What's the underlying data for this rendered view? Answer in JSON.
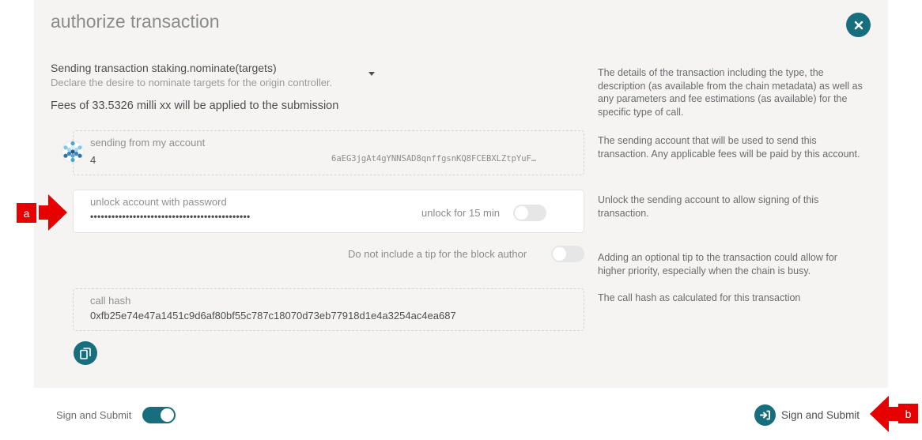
{
  "modal": {
    "title": "authorize transaction",
    "close_icon": "close-icon"
  },
  "transaction": {
    "method": "Sending transaction staking.nominate(targets)",
    "description": "Declare the desire to nominate targets for the origin controller.",
    "fees": "Fees of 33.5326 milli xx will be applied to the submission"
  },
  "account": {
    "label": "sending from my account",
    "name": "4",
    "address": "6aEG3jgAt4gYNNSAD8qnffgsnKQ8FCEBXLZtpYuF…"
  },
  "password": {
    "label": "unlock account with password",
    "value": "•••••••••••••••••••••••••••••••••••••••••••••",
    "unlock_label": "unlock for 15 min",
    "unlock_enabled": false
  },
  "tip": {
    "label": "Do not include a tip for the block author",
    "enabled": false
  },
  "call_hash": {
    "label": "call hash",
    "value": "0xfb25e74e47a1451c9d6af80bf55c787c18070d73eb77918d1e4a3254ac4ea687"
  },
  "help": {
    "details": "The details of the transaction including the type, the description (as available from the chain metadata) as well as any parameters and fee estimations (as available) for the specific type of call.",
    "account": "The sending account that will be used to send this transaction. Any applicable fees will be paid by this account.",
    "unlock": "Unlock the sending account to allow signing of this transaction.",
    "tip": "Adding an optional tip to the transaction could allow for higher priority, especially when the chain is busy.",
    "hash": "The call hash as calculated for this transaction"
  },
  "footer": {
    "sign_toggle_label": "Sign and Submit",
    "sign_toggle_enabled": true,
    "submit_label": "Sign and Submit"
  },
  "annotations": {
    "marker_a": "a",
    "marker_b": "b"
  },
  "colors": {
    "accent": "#176e7d",
    "marker": "#e60000"
  }
}
